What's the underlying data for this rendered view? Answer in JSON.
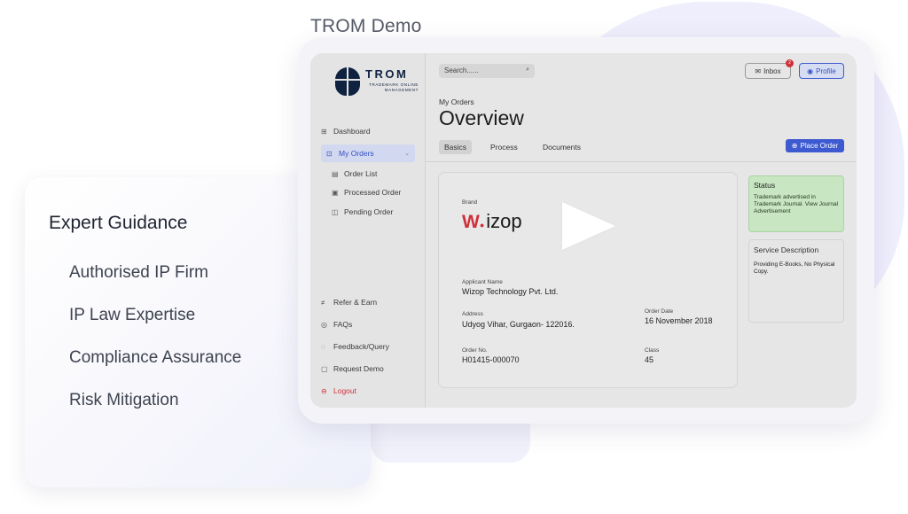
{
  "demo_title": "TROM Demo",
  "guidance": {
    "heading": "Expert Guidance",
    "items": [
      "Authorised IP Firm",
      "IP Law Expertise",
      "Compliance Assurance",
      "Risk Mitigation"
    ]
  },
  "app": {
    "logo": {
      "word": "TROM",
      "subtitle": "TRADEMARK ONLINE MANAGEMENT"
    },
    "sidebar": {
      "dashboard": "Dashboard",
      "my_orders": "My Orders",
      "order_list": "Order List",
      "processed_order": "Processed Order",
      "pending_order": "Pending Order",
      "refer_earn": "Refer & Earn",
      "faqs": "FAQs",
      "feedback": "Feedback/Query",
      "request_demo": "Request Demo",
      "logout": "Logout"
    },
    "header": {
      "search_placeholder": "Search......",
      "inbox_label": "Inbox",
      "inbox_badge": "2",
      "profile_label": "Profile"
    },
    "breadcrumb": "My Orders",
    "page_title": "Overview",
    "tabs": [
      "Basics",
      "Process",
      "Documents"
    ],
    "place_order_label": "Place Order",
    "order": {
      "brand_label": "Brand",
      "brand_name": "izop",
      "applicant_label": "Applicant Name",
      "applicant_value": "Wizop Technology Pvt. Ltd.",
      "address_label": "Address",
      "address_value": "Udyog Vihar, Gurgaon- 122016.",
      "order_date_label": "Order Date",
      "order_date_value": "16 November 2018",
      "order_no_label": "Order No.",
      "order_no_value": "H01415-000070",
      "class_label": "Class",
      "class_value": "45"
    },
    "status": {
      "title": "Status",
      "text": "Trademark advertised in Trademark Journal. View Journal Advertisement"
    },
    "service": {
      "title": "Service Description",
      "text": "Providing E-Books, No Physical Copy."
    }
  },
  "colors": {
    "accent": "#3e5ad0",
    "logout": "#d0303a",
    "status_bg": "#c7e6c1",
    "brand_navy": "#0f2240"
  }
}
